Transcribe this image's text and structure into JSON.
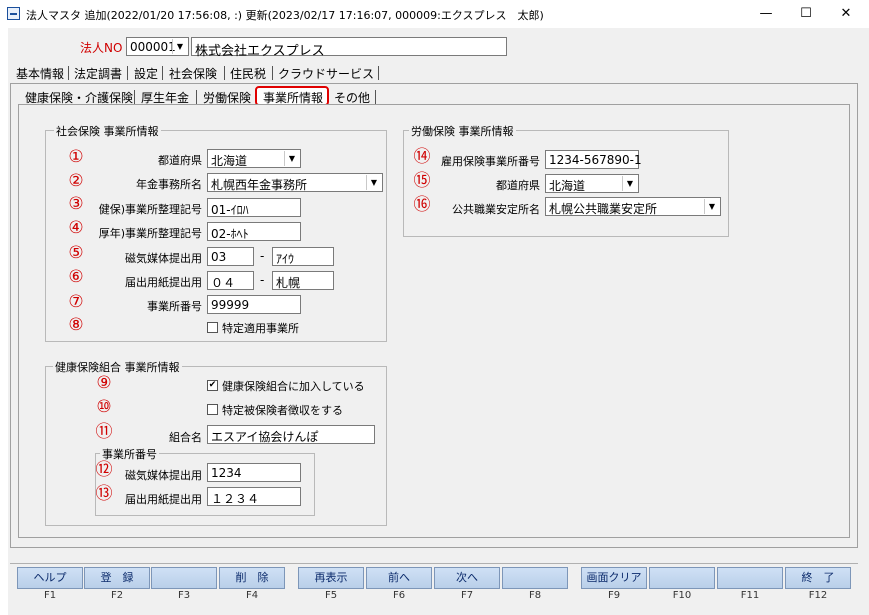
{
  "window": {
    "title": "法人マスタ 追加(2022/01/20 17:56:08, :) 更新(2023/02/17 17:16:07, 000009:エクスプレス　太郎)",
    "minimize": "—",
    "maximize": "☐",
    "close": "✕"
  },
  "header": {
    "corp_no_label": "法人NO",
    "corp_no_value": "000001",
    "corp_name": "株式会社エクスプレス"
  },
  "main_tabs": [
    "基本情報",
    "法定調書",
    "設定",
    "社会保険",
    "住民税",
    "クラウドサービス"
  ],
  "sub_tabs": [
    "健康保険・介護保険",
    "厚生年金",
    "労働保険",
    "事業所情報",
    "その他"
  ],
  "colors": {
    "highlight_red": "#d00000",
    "fkey_blue": "#c5d9f1"
  },
  "social": {
    "title": "社会保険 事業所情報",
    "rows": [
      {
        "num": "①",
        "label": "都道府県",
        "value": "北海道"
      },
      {
        "num": "②",
        "label": "年金事務所名",
        "value": "札幌西年金事務所"
      },
      {
        "num": "③",
        "label": "健保)事業所整理記号",
        "value": "01-ｲﾛﾊ"
      },
      {
        "num": "④",
        "label": "厚年)事業所整理記号",
        "value": "02-ﾎﾍﾄ"
      },
      {
        "num": "⑤",
        "label": "磁気媒体提出用",
        "value": "03",
        "value2": "ｱｲｳ"
      },
      {
        "num": "⑥",
        "label": "届出用紙提出用",
        "value": "０４",
        "value2": "札幌"
      },
      {
        "num": "⑦",
        "label": "事業所番号",
        "value": "99999"
      },
      {
        "num": "⑧",
        "label": "特定適用事業所"
      }
    ],
    "dash": "-"
  },
  "health": {
    "title": "健康保険組合 事業所情報",
    "rows": [
      {
        "num": "⑨",
        "label": "健康保険組合に加入している",
        "checked": "✔"
      },
      {
        "num": "⑩",
        "label": "特定被保険者徴収をする"
      },
      {
        "num": "⑪",
        "label": "組合名",
        "value": "エスアイ協会けんぽ"
      }
    ],
    "office_no_title": "事業所番号",
    "office_rows": [
      {
        "num": "⑫",
        "label": "磁気媒体提出用",
        "value": "1234"
      },
      {
        "num": "⑬",
        "label": "届出用紙提出用",
        "value": "１２３４"
      }
    ]
  },
  "labor": {
    "title": "労働保険 事業所情報",
    "rows": [
      {
        "num": "⑭",
        "label": "雇用保険事業所番号",
        "value": "1234-567890-1"
      },
      {
        "num": "⑮",
        "label": "都道府県",
        "value": "北海道"
      },
      {
        "num": "⑯",
        "label": "公共職業安定所名",
        "value": "札幌公共職業安定所"
      }
    ]
  },
  "fkeys": [
    {
      "label": "ヘルプ",
      "key": "F1"
    },
    {
      "label": "登　録",
      "key": "F2"
    },
    {
      "label": "",
      "key": "F3"
    },
    {
      "label": "削　除",
      "key": "F4"
    },
    {
      "label": "再表示",
      "key": "F5"
    },
    {
      "label": "前へ",
      "key": "F6"
    },
    {
      "label": "次へ",
      "key": "F7"
    },
    {
      "label": "",
      "key": "F8"
    },
    {
      "label": "画面クリア",
      "key": "F9"
    },
    {
      "label": "",
      "key": "F10"
    },
    {
      "label": "",
      "key": "F11"
    },
    {
      "label": "終　了",
      "key": "F12"
    }
  ]
}
